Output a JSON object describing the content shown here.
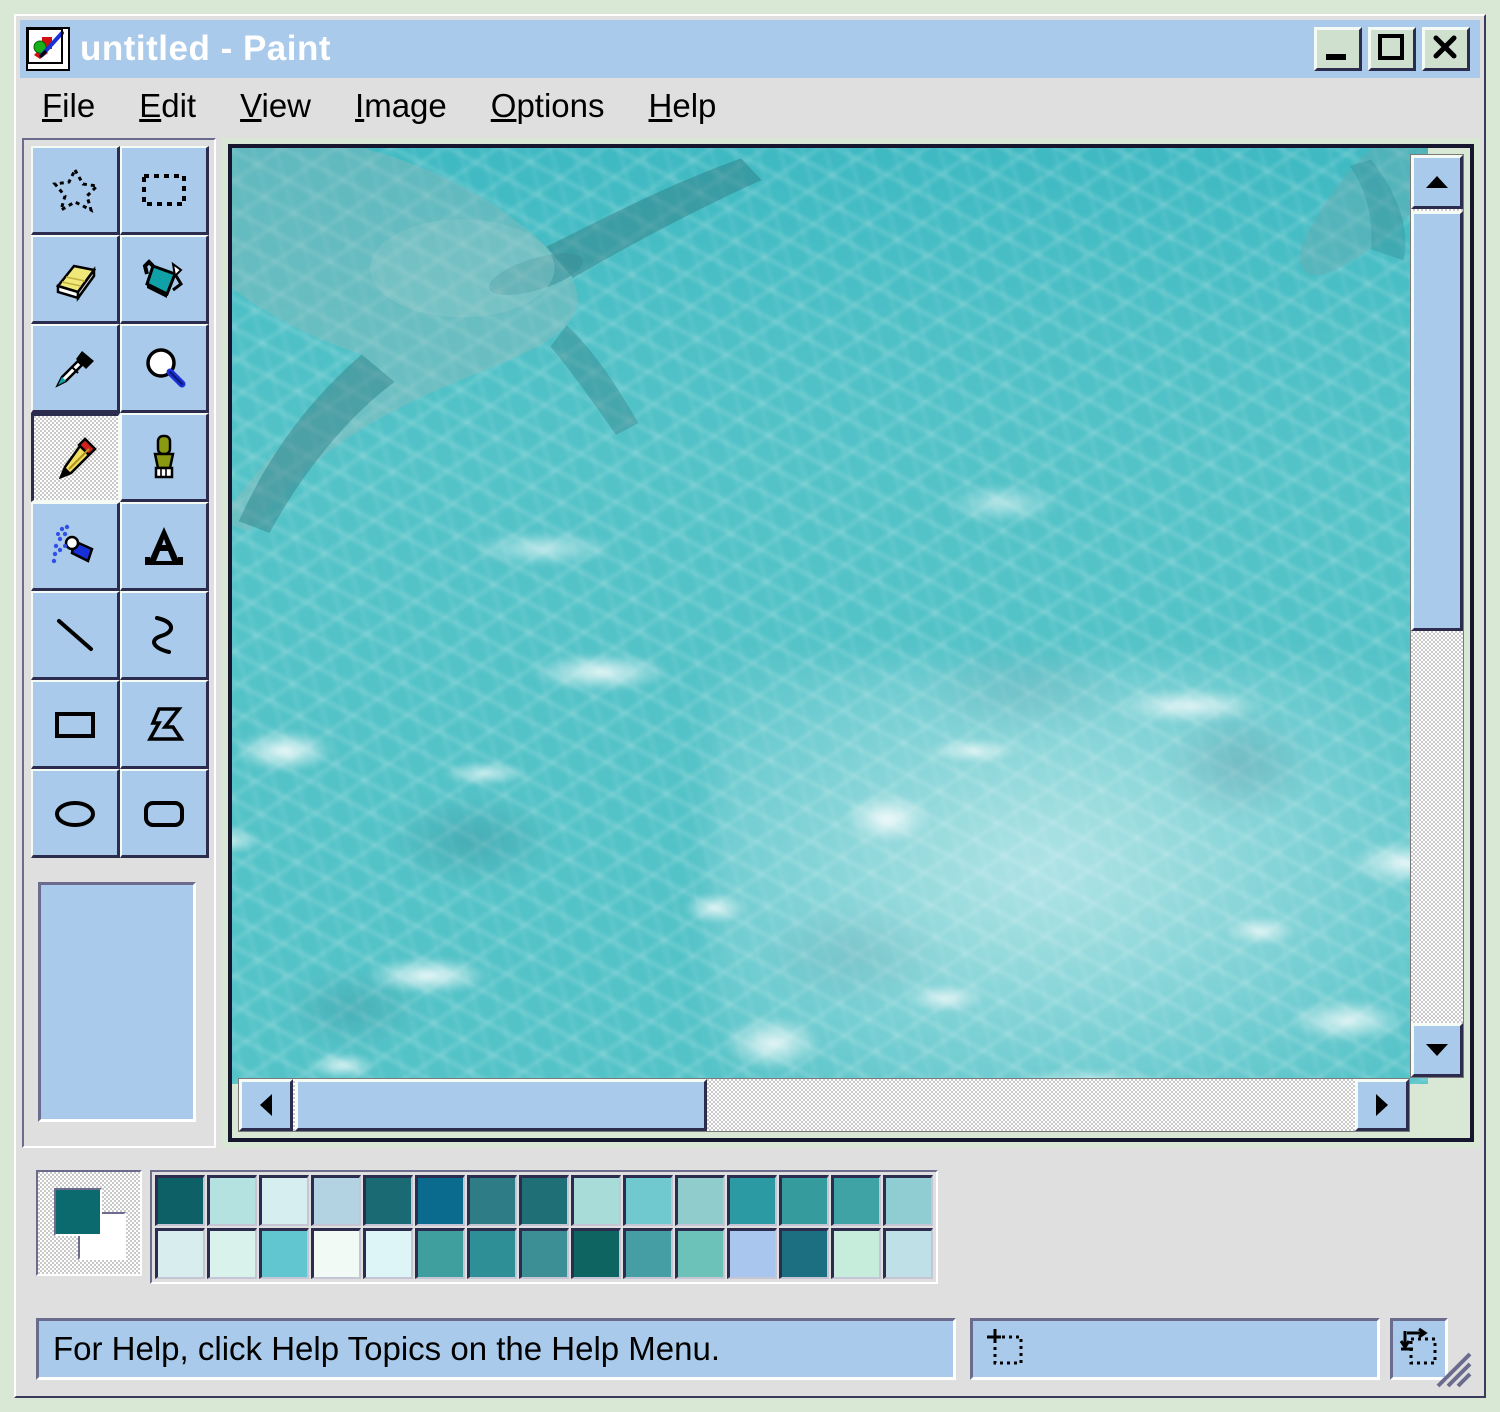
{
  "window": {
    "title": "untitled - Paint",
    "icon": "paint-app-icon",
    "buttons": [
      {
        "name": "minimize",
        "glyph": "_"
      },
      {
        "name": "maximize",
        "glyph": "□"
      },
      {
        "name": "close",
        "glyph": "✕"
      }
    ]
  },
  "menu": [
    {
      "label": "File",
      "mnemonic": "F",
      "rest": "ile"
    },
    {
      "label": "Edit",
      "mnemonic": "E",
      "rest": "dit"
    },
    {
      "label": "View",
      "mnemonic": "V",
      "rest": "iew"
    },
    {
      "label": "Image",
      "mnemonic": "I",
      "rest": "mage"
    },
    {
      "label": "Options",
      "mnemonic": "O",
      "rest": "ptions"
    },
    {
      "label": "Help",
      "mnemonic": "H",
      "rest": "elp"
    }
  ],
  "toolbox": {
    "tools": [
      {
        "name": "free-form-select",
        "label": "Free-Form Select",
        "selected": false
      },
      {
        "name": "rectangle-select",
        "label": "Select",
        "selected": false
      },
      {
        "name": "eraser",
        "label": "Eraser/Color Eraser",
        "selected": false
      },
      {
        "name": "fill-with-color",
        "label": "Fill With Color",
        "selected": false
      },
      {
        "name": "pick-color",
        "label": "Pick Color",
        "selected": false
      },
      {
        "name": "magnifier",
        "label": "Magnifier",
        "selected": false
      },
      {
        "name": "pencil",
        "label": "Pencil",
        "selected": true
      },
      {
        "name": "brush",
        "label": "Brush",
        "selected": false
      },
      {
        "name": "airbrush",
        "label": "Airbrush",
        "selected": false
      },
      {
        "name": "text",
        "label": "Text",
        "selected": false
      },
      {
        "name": "line",
        "label": "Line",
        "selected": false
      },
      {
        "name": "curve",
        "label": "Curve",
        "selected": false
      },
      {
        "name": "rectangle",
        "label": "Rectangle",
        "selected": false
      },
      {
        "name": "polygon",
        "label": "Polygon",
        "selected": false
      },
      {
        "name": "ellipse",
        "label": "Ellipse",
        "selected": false
      },
      {
        "name": "rounded-rectangle",
        "label": "Rounded Rectangle",
        "selected": false
      }
    ],
    "options_panel_empty": true
  },
  "canvas": {
    "scene": "underwater shallow turquoise sea with sunlight caustics on sandy bottom and stingrays",
    "scrollbars": {
      "vertical": {
        "thumb_start_pct": 0,
        "thumb_size_pct": 49,
        "up_glyph": "▲",
        "down_glyph": "▼"
      },
      "horizontal": {
        "thumb_start_pct": 0,
        "thumb_size_pct": 37,
        "left_glyph": "◀",
        "right_glyph": "▶"
      }
    }
  },
  "palette": {
    "foreground": "#0a6a6e",
    "background": "#ffffff",
    "row1": [
      "#0c6066",
      "#b4e2e0",
      "#d6eeef",
      "#b3d2e2",
      "#196a72",
      "#0a6b8f",
      "#2e7d86",
      "#1f6f77",
      "#a8dcd8",
      "#6fc9cf",
      "#8fcccb",
      "#2c9aa3",
      "#359b9c",
      "#3fa3a6",
      "#8fcdd2"
    ],
    "row2": [
      "#d7edee",
      "#d9f2ec",
      "#61c6cf",
      "#f2faf6",
      "#ddf5f7",
      "#3f9f9f",
      "#2e8f96",
      "#3b8f95",
      "#0d6460",
      "#459ea4",
      "#6cc1b9",
      "#a9c6ee",
      "#1b6f80",
      "#c6ecdc",
      "#bfe0e6"
    ]
  },
  "status": {
    "help_text": "For Help, click Help Topics on the Help Menu.",
    "position_value": "",
    "size_value": "",
    "position_icon": "cursor-position-icon",
    "size_icon": "selection-size-icon"
  }
}
